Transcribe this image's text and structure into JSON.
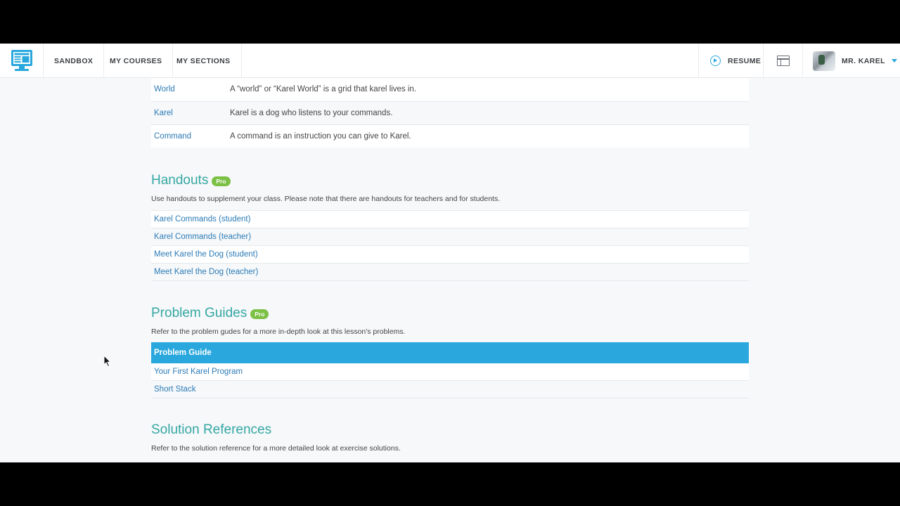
{
  "nav": {
    "items": [
      {
        "label": "SANDBOX"
      },
      {
        "label": "MY COURSES"
      },
      {
        "label": "MY SECTIONS"
      }
    ],
    "resume_label": "RESUME",
    "user_name": "MR. KAREL"
  },
  "vocab": [
    {
      "term": "World",
      "definition": "A “world” or “Karel World” is a grid that karel lives in."
    },
    {
      "term": "Karel",
      "definition": "Karel is a dog who listens to your commands."
    },
    {
      "term": "Command",
      "definition": "A command is an instruction you can give to Karel."
    }
  ],
  "handouts": {
    "title": "Handouts",
    "badge": "Pro",
    "description": "Use handouts to supplement your class. Please note that there are handouts for teachers and for students.",
    "items": [
      {
        "label": "Karel Commands (student)"
      },
      {
        "label": "Karel Commands (teacher)"
      },
      {
        "label": "Meet Karel the Dog (student)"
      },
      {
        "label": "Meet Karel the Dog (teacher)"
      }
    ]
  },
  "problem_guides": {
    "title": "Problem Guides",
    "badge": "Pro",
    "description": "Refer to the problem gudes for a more in-depth look at this lesson's problems.",
    "header": "Problem Guide",
    "items": [
      {
        "label": "Your First Karel Program"
      },
      {
        "label": "Short Stack"
      }
    ]
  },
  "solution_references": {
    "title": "Solution References",
    "description": "Refer to the solution reference for a more detailed look at exercise solutions."
  },
  "colors": {
    "accent_blue": "#2aa8de",
    "section_teal": "#35a7a3",
    "pro_green": "#7cc046",
    "link_blue": "#2c7bb6"
  },
  "icons": {
    "logo": "computer-monitor-logo-icon",
    "resume": "play-circle-icon",
    "window": "browser-window-icon",
    "caret": "caret-down-icon",
    "cursor": "mouse-pointer-icon"
  }
}
